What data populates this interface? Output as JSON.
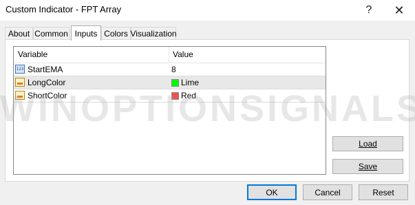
{
  "window": {
    "title": "Custom Indicator - FPT Array",
    "help_glyph": "?",
    "close_glyph": "✕"
  },
  "tabs": [
    {
      "label": "About"
    },
    {
      "label": "Common"
    },
    {
      "label": "Inputs",
      "active": true
    },
    {
      "label": "Colors"
    },
    {
      "label": "Visualization"
    }
  ],
  "grid": {
    "columns": {
      "variable": "Variable",
      "value": "Value"
    },
    "rows": [
      {
        "icon": "integer-icon",
        "icon_text": "123",
        "name": "StartEMA",
        "value": "8"
      },
      {
        "icon": "color-icon",
        "name": "LongColor",
        "value": "Lime",
        "swatch": "#00ff00",
        "selected": true
      },
      {
        "icon": "color-icon",
        "name": "ShortColor",
        "value": "Red",
        "swatch": "#f05050"
      }
    ]
  },
  "side_buttons": {
    "load_label": "Load",
    "save_label": "Save"
  },
  "footer": {
    "ok_label": "OK",
    "cancel_label": "Cancel",
    "reset_label": "Reset"
  },
  "watermark": "WINOPTIONSIGNALS.COM",
  "colors": {
    "accent": "#0078d7",
    "lime": "#00ff00",
    "red": "#f05050"
  }
}
